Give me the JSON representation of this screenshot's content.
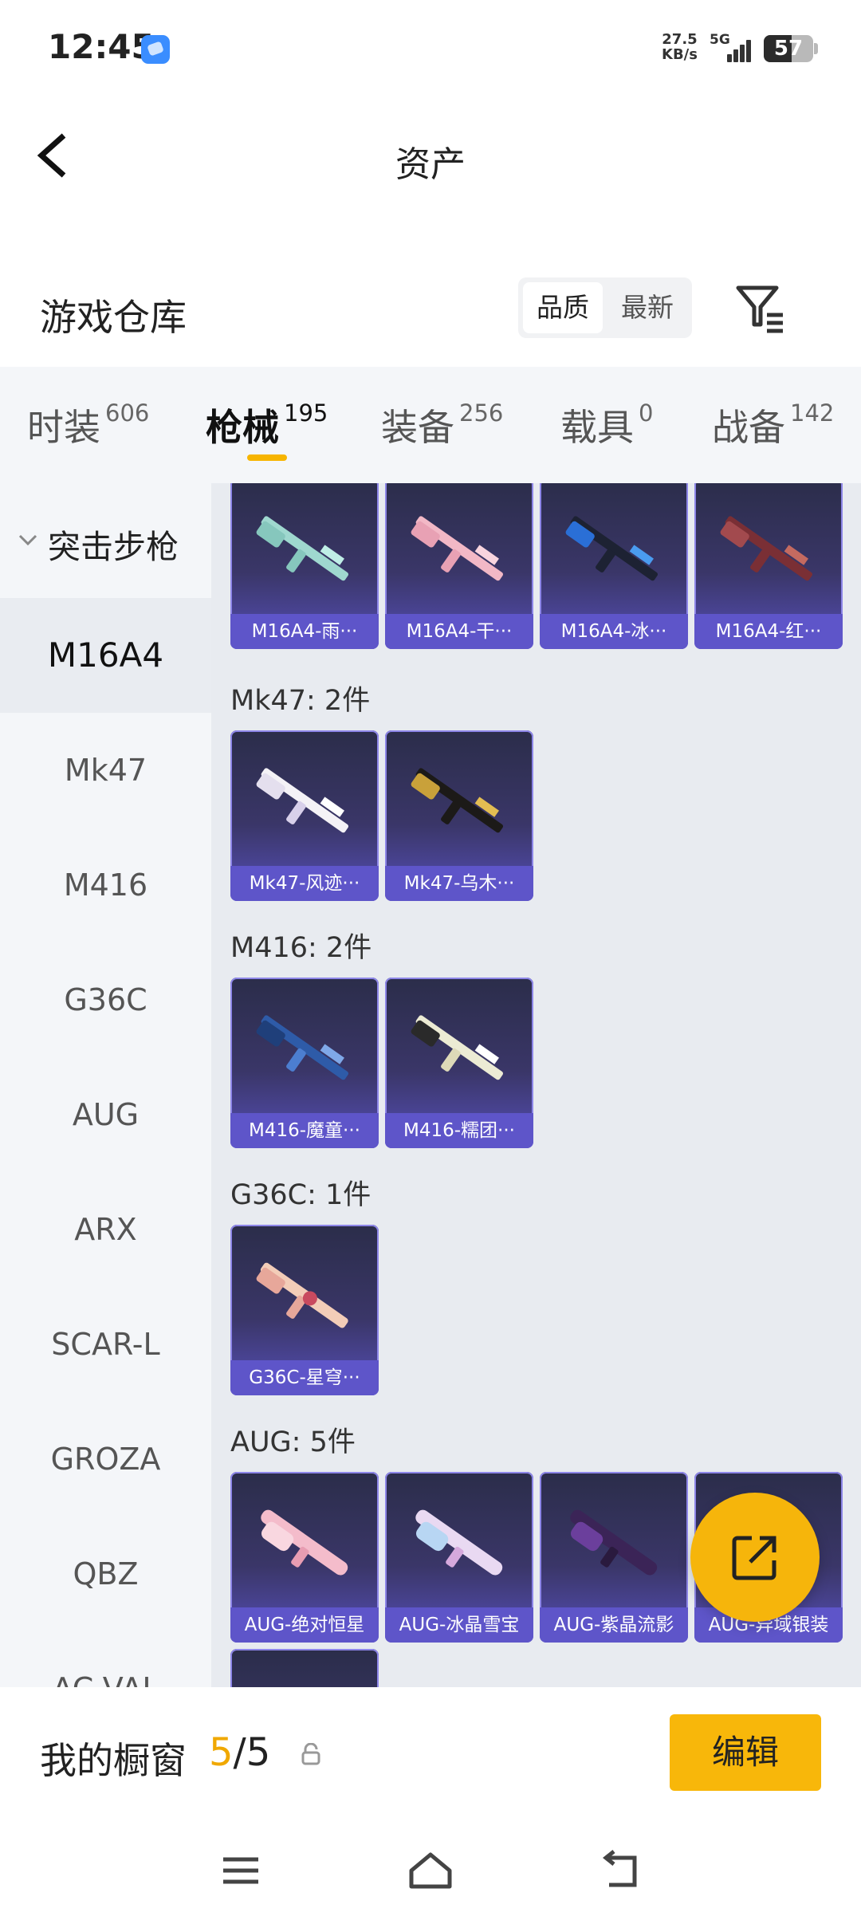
{
  "status_bar": {
    "time": "12:45",
    "net_speed_value": "27.5",
    "net_speed_unit": "KB/s",
    "network_type": "5G",
    "battery": "57",
    "battery_level": 0.57
  },
  "header": {
    "title": "资产"
  },
  "warehouse": {
    "title": "游戏仓库",
    "sort_options": [
      "品质",
      "最新"
    ],
    "sort_selected": "品质"
  },
  "tabs": [
    {
      "label": "时装",
      "count": "606"
    },
    {
      "label": "枪械",
      "count": "195",
      "active": true
    },
    {
      "label": "装备",
      "count": "256"
    },
    {
      "label": "载具",
      "count": "0"
    },
    {
      "label": "战备",
      "count": "142"
    }
  ],
  "sidebar": {
    "group": "突击步枪",
    "items": [
      "M16A4",
      "Mk47",
      "M416",
      "G36C",
      "AUG",
      "ARX",
      "SCAR-L",
      "GROZA",
      "QBZ",
      "AC-VAL"
    ],
    "active": "M16A4"
  },
  "sections": [
    {
      "title": "",
      "items": [
        "M16A4-雨···",
        "M16A4-干···",
        "M16A4-冰···",
        "M16A4-红···"
      ]
    },
    {
      "title": "Mk47: 2件",
      "items": [
        "Mk47-风迹···",
        "Mk47-乌木···"
      ]
    },
    {
      "title": "M416: 2件",
      "items": [
        "M416-魔童···",
        "M416-糯团···"
      ]
    },
    {
      "title": "G36C: 1件",
      "items": [
        "G36C-星穹···"
      ]
    },
    {
      "title": "AUG: 5件",
      "items": [
        "AUG-绝对恒星",
        "AUG-冰晶雪宝",
        "AUG-紫晶流影",
        "AUG-异域银装",
        ""
      ]
    }
  ],
  "bottom_bar": {
    "label": "我的橱窗",
    "current": "5",
    "total": "/5",
    "edit_label": "编辑"
  },
  "colors": {
    "accent": "#f7b500",
    "card_bg": "#3a3668",
    "card_label": "#5e55c9"
  },
  "icons": [
    "back-arrow-icon",
    "filter-icon",
    "share-icon",
    "lock-icon",
    "menu-icon",
    "home-icon",
    "back-icon"
  ]
}
